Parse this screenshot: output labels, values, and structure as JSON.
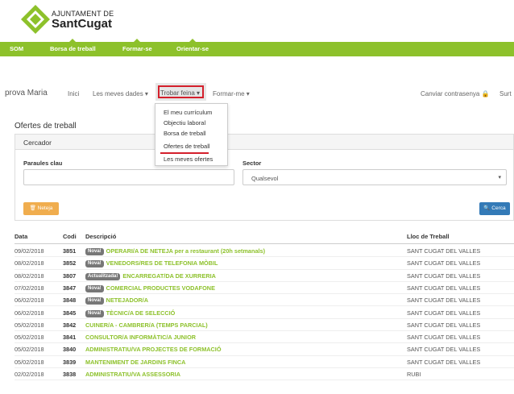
{
  "logo": {
    "line1": "AJUNTAMENT DE",
    "line2": "SantCugat"
  },
  "topnav": [
    "SOM",
    "Borsa de treball",
    "Formar-se",
    "Orientar-se"
  ],
  "usernav": {
    "user": "prova Maria",
    "inici": "Inici",
    "meves_dades": "Les meves dades ▾",
    "trobar_feina": "Trobar feina ▾",
    "formar_me": "Formar-me ▾",
    "canviar": "Canviar contrasenya 🔒",
    "surt": "Surt"
  },
  "dropdown": [
    "El meu currículum",
    "Objectiu laboral",
    "Borsa de treball",
    "Ofertes de treball",
    "Les meves ofertes"
  ],
  "page_title": "Ofertes de treball",
  "search": {
    "panel_title": "Cercador",
    "keywords_label": "Paraules clau",
    "keywords_value": "",
    "sector_label": "Sector",
    "sector_value": "Qualsevol",
    "clear_label": "🗑 Neteja",
    "search_label": "🔍 Cerca"
  },
  "table": {
    "headers": [
      "Data",
      "Codi",
      "Descripció",
      "Lloc de Treball"
    ],
    "rows": [
      {
        "date": "09/02/2018",
        "code": "3851",
        "badge": "Nova!",
        "desc": "OPERARI/A DE NETEJA per a restaurant (20h setmanals)",
        "place": "SANT CUGAT DEL VALLES"
      },
      {
        "date": "08/02/2018",
        "code": "3852",
        "badge": "Nova!",
        "desc": "VENEDORS/RES DE TELEFONIA MÒBIL",
        "place": "SANT CUGAT DEL VALLES"
      },
      {
        "date": "08/02/2018",
        "code": "3807",
        "badge": "Actualitzada!",
        "desc": "ENCARREGAT/DA DE XURRERIA",
        "place": "SANT CUGAT DEL VALLES"
      },
      {
        "date": "07/02/2018",
        "code": "3847",
        "badge": "Nova!",
        "desc": "COMERCIAL PRODUCTES VODAFONE",
        "place": "SANT CUGAT DEL VALLES"
      },
      {
        "date": "06/02/2018",
        "code": "3848",
        "badge": "Nova!",
        "desc": "NETEJADOR/A",
        "place": "SANT CUGAT DEL VALLES"
      },
      {
        "date": "06/02/2018",
        "code": "3845",
        "badge": "Nova!",
        "desc": "TÈCNIC/A DE SELECCIÓ",
        "place": "SANT CUGAT DEL VALLES"
      },
      {
        "date": "05/02/2018",
        "code": "3842",
        "badge": "",
        "desc": "CUINER/A - CAMBRER/A (TEMPS PARCIAL)",
        "place": "SANT CUGAT DEL VALLES"
      },
      {
        "date": "05/02/2018",
        "code": "3841",
        "badge": "",
        "desc": "CONSULTOR/A INFORMÀTIC/A JUNIOR",
        "place": "SANT CUGAT DEL VALLES"
      },
      {
        "date": "05/02/2018",
        "code": "3840",
        "badge": "",
        "desc": "ADMINISTRATIU/VA PROJECTES DE FORMACIÓ",
        "place": "SANT CUGAT DEL VALLES"
      },
      {
        "date": "05/02/2018",
        "code": "3839",
        "badge": "",
        "desc": "MANTENIMENT DE JARDINS FINCA",
        "place": "SANT CUGAT DEL VALLES"
      },
      {
        "date": "02/02/2018",
        "code": "3838",
        "badge": "",
        "desc": "ADMINISTRATIU/VA ASSESSORIA",
        "place": "RUBI"
      }
    ]
  }
}
